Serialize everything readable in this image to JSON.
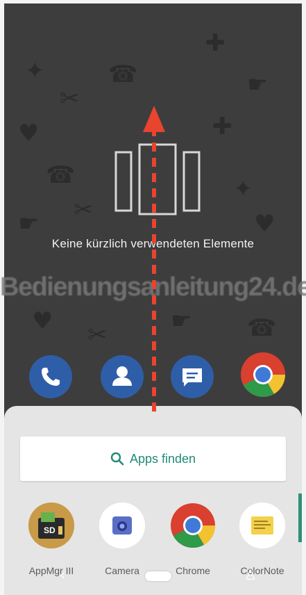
{
  "recents": {
    "empty_message": "Keine kürzlich verwendeten Elemente"
  },
  "watermark": {
    "text": "Bedienungsanleitung24.de"
  },
  "dock": {
    "apps": [
      {
        "name": "phone",
        "icon": "phone-icon"
      },
      {
        "name": "contacts",
        "icon": "person-icon"
      },
      {
        "name": "messages",
        "icon": "message-icon"
      },
      {
        "name": "chrome",
        "icon": "chrome-icon"
      }
    ]
  },
  "app_drawer": {
    "search_label": "Apps finden",
    "search_icon": "search-icon",
    "apps": [
      {
        "label": "AppMgr III",
        "icon": "sd-card-icon"
      },
      {
        "label": "Camera",
        "icon": "camera-icon"
      },
      {
        "label": "Chrome",
        "icon": "chrome-icon"
      },
      {
        "label": "ColorNote",
        "icon": "note-icon"
      }
    ]
  },
  "colors": {
    "accent": "#1f8a7a",
    "arrow": "#e8442e",
    "dock_blue": "#2f5ea8"
  }
}
